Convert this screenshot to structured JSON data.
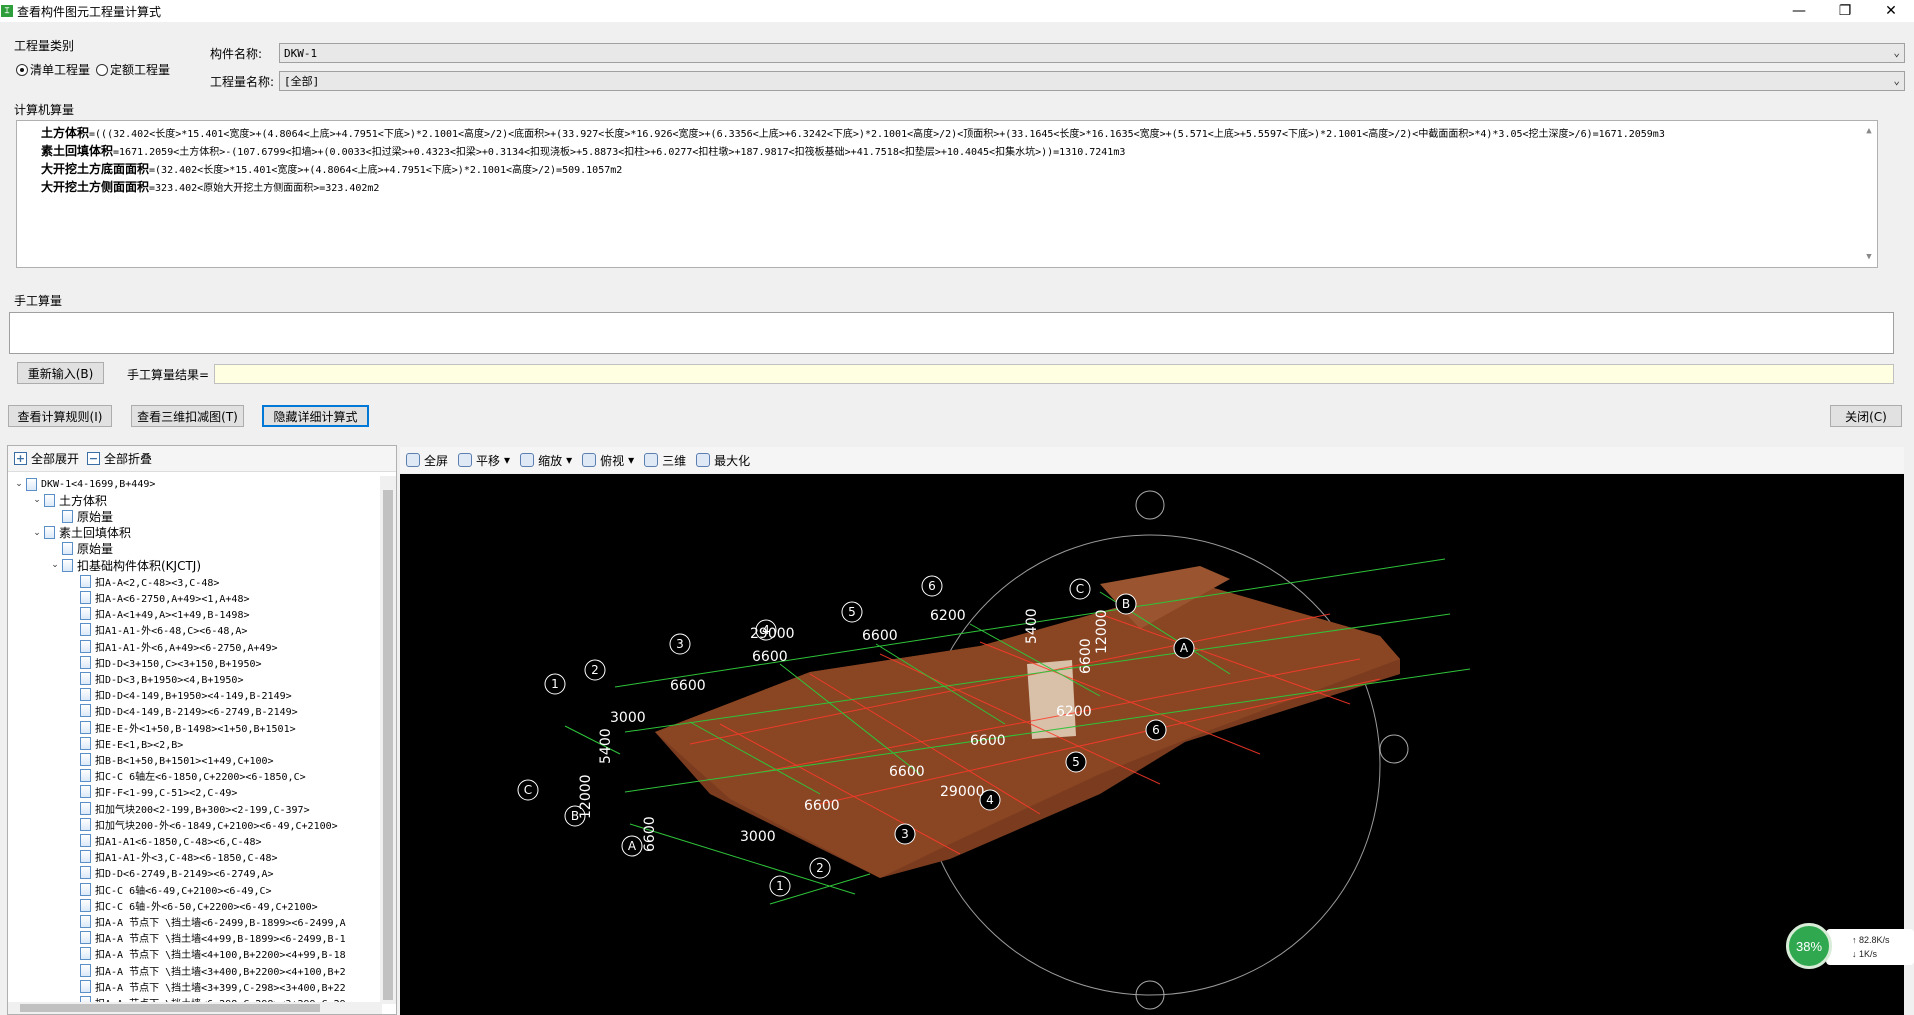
{
  "window": {
    "title": "查看构件图元工程量计算式",
    "controls": [
      "—",
      "❐",
      "✕"
    ]
  },
  "quantity_type": {
    "group_label": "工程量类别",
    "options": [
      {
        "label": "清单工程量",
        "selected": true
      },
      {
        "label": "定额工程量",
        "selected": false
      }
    ]
  },
  "component": {
    "name_label": "构件名称:",
    "name_value": "DKW-1",
    "quantity_label": "工程量名称:",
    "quantity_value": "[全部]"
  },
  "computer_calc": {
    "group_label": "计算机算量",
    "lines": [
      {
        "name": "土方体积",
        "formula": "=(((32.402<长度>*15.401<宽度>+(4.8064<上底>+4.7951<下底>)*2.1001<高度>/2)<底面积>+(33.927<长度>*16.926<宽度>+(6.3356<上底>+6.3242<下底>)*2.1001<高度>/2)<顶面积>+(33.1645<长度>*16.1635<宽度>+(5.571<上底>+5.5597<下底>)*2.1001<高度>/2)<中截面面积>*4)*3.05<挖土深度>/6)=1671.2059m3"
      },
      {
        "name": "素土回填体积",
        "formula": "=1671.2059<土方体积>-(107.6799<扣墙>+(0.0033<扣过梁>+0.4323<扣梁>+0.3134<扣现浇板>+5.8873<扣柱>+6.0277<扣柱墩>+187.9817<扣筏板基础>+41.7518<扣垫层>+10.4045<扣集水坑>))=1310.7241m3"
      },
      {
        "name": "大开挖土方底面面积",
        "formula": "=(32.402<长度>*15.401<宽度>+(4.8064<上底>+4.7951<下底>)*2.1001<高度>/2)=509.1057m2"
      },
      {
        "name": "大开挖土方侧面面积",
        "formula": "=323.402<原始大开挖土方侧面面积>=323.402m2"
      }
    ]
  },
  "manual_calc": {
    "group_label": "手工算量",
    "reinput_button": "重新输入(B)",
    "result_label": "手工算量结果="
  },
  "actions": {
    "rules_button": "查看计算规则(I)",
    "view3d_button": "查看三维扣减图(T)",
    "hide_button": "隐藏详细计算式",
    "close_button": "关闭(C)"
  },
  "tree_toolbar": {
    "expand_all": "全部展开",
    "collapse_all": "全部折叠"
  },
  "tree": [
    {
      "level": 0,
      "text": "DKW-1<4-1699,B+449>",
      "expand": "v"
    },
    {
      "level": 1,
      "text": "土方体积",
      "expand": "v",
      "cn": true
    },
    {
      "level": 2,
      "text": "原始量",
      "expand": "",
      "cn": true
    },
    {
      "level": 1,
      "text": "素土回填体积",
      "expand": "v",
      "cn": true
    },
    {
      "level": 2,
      "text": "原始量",
      "expand": "",
      "cn": true
    },
    {
      "level": 2,
      "text": "扣基础构件体积(KJCTJ)",
      "expand": "v",
      "cn": true
    },
    {
      "level": 3,
      "text": "扣A-A<2,C-48><3,C-48>",
      "expand": ""
    },
    {
      "level": 3,
      "text": "扣A-A<6-2750,A+49><1,A+48>",
      "expand": ""
    },
    {
      "level": 3,
      "text": "扣A-A<1+49,A><1+49,B-1498>",
      "expand": ""
    },
    {
      "level": 3,
      "text": "扣A1-A1-外<6-48,C><6-48,A>",
      "expand": ""
    },
    {
      "level": 3,
      "text": "扣A1-A1-外<6,A+49><6-2750,A+49>",
      "expand": ""
    },
    {
      "level": 3,
      "text": "扣D-D<3+150,C><3+150,B+1950>",
      "expand": ""
    },
    {
      "level": 3,
      "text": "扣D-D<3,B+1950><4,B+1950>",
      "expand": ""
    },
    {
      "level": 3,
      "text": "扣D-D<4-149,B+1950><4-149,B-2149>",
      "expand": ""
    },
    {
      "level": 3,
      "text": "扣D-D<4-149,B-2149><6-2749,B-2149>",
      "expand": ""
    },
    {
      "level": 3,
      "text": "扣E-E-外<1+50,B-1498><1+50,B+1501>",
      "expand": ""
    },
    {
      "level": 3,
      "text": "扣E-E<1,B><2,B>",
      "expand": ""
    },
    {
      "level": 3,
      "text": "扣B-B<1+50,B+1501><1+49,C+100>",
      "expand": ""
    },
    {
      "level": 3,
      "text": "扣C-C 6轴左<6-1850,C+2200><6-1850,C>",
      "expand": ""
    },
    {
      "level": 3,
      "text": "扣F-F<1-99,C-51><2,C-49>",
      "expand": ""
    },
    {
      "level": 3,
      "text": "扣加气块200<2-199,B+300><2-199,C-397>",
      "expand": ""
    },
    {
      "level": 3,
      "text": "扣加气块200-外<6-1849,C+2100><6-49,C+2100>",
      "expand": ""
    },
    {
      "level": 3,
      "text": "扣A1-A1<6-1850,C-48><6,C-48>",
      "expand": ""
    },
    {
      "level": 3,
      "text": "扣A1-A1-外<3,C-48><6-1850,C-48>",
      "expand": ""
    },
    {
      "level": 3,
      "text": "扣D-D<6-2749,B-2149><6-2749,A>",
      "expand": ""
    },
    {
      "level": 3,
      "text": "扣C-C 6轴<6-49,C+2100><6-49,C>",
      "expand": ""
    },
    {
      "level": 3,
      "text": "扣C-C 6轴-外<6-50,C+2200><6-49,C+2100>",
      "expand": ""
    },
    {
      "level": 3,
      "text": "扣A-A 节点下 \\挡土墙<6-2499,B-1899><6-2499,A",
      "expand": ""
    },
    {
      "level": 3,
      "text": "扣A-A 节点下 \\挡土墙<4+99,B-1899><6-2499,B-1",
      "expand": ""
    },
    {
      "level": 3,
      "text": "扣A-A 节点下 \\挡土墙<4+100,B+2200><4+99,B-18",
      "expand": ""
    },
    {
      "level": 3,
      "text": "扣A-A 节点下 \\挡土墙<3+400,B+2200><4+100,B+2",
      "expand": ""
    },
    {
      "level": 3,
      "text": "扣A-A 节点下 \\挡土墙<3+399,C-298><3+400,B+22",
      "expand": ""
    },
    {
      "level": 3,
      "text": "扣A-A 节点下 \\挡土墙<6-298,C-298><3+299,C-29",
      "expand": ""
    }
  ],
  "view_toolbar": {
    "fullscreen": "全屏",
    "pan": "平移",
    "zoom": "缩放",
    "top_view": "俯视",
    "three_d": "三维",
    "maximize": "最大化"
  },
  "viewport": {
    "dims": [
      "29000",
      "6600",
      "6600",
      "3000",
      "5400",
      "12000",
      "6600",
      "6200",
      "6600",
      "5400",
      "12000",
      "6600",
      "6200",
      "6600",
      "6600",
      "29000",
      "6600",
      "3000"
    ],
    "axis_labels": [
      "1",
      "2",
      "3",
      "4",
      "5",
      "6",
      "A",
      "B",
      "C",
      "1",
      "2",
      "3",
      "4",
      "5",
      "6",
      "A",
      "B",
      "C"
    ]
  },
  "net_monitor": {
    "cpu": "38%",
    "up": "82.8K/s",
    "down": "1K/s"
  }
}
